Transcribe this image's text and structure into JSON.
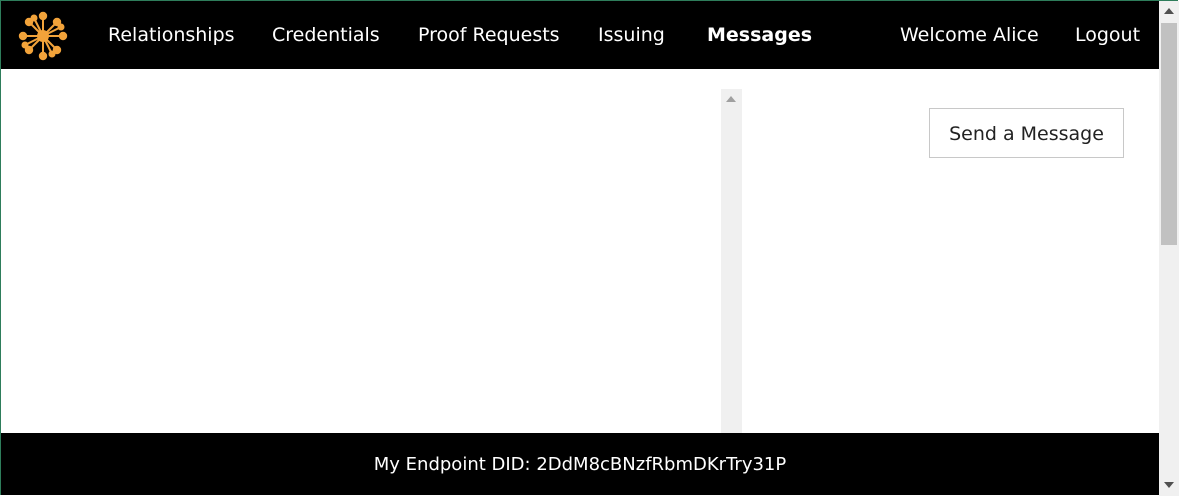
{
  "nav": {
    "logo_icon": "sunburst-logo-icon",
    "items": [
      {
        "label": "Relationships",
        "active": false
      },
      {
        "label": "Credentials",
        "active": false
      },
      {
        "label": "Proof Requests",
        "active": false
      },
      {
        "label": "Issuing",
        "active": false
      },
      {
        "label": "Messages",
        "active": true
      }
    ],
    "welcome": "Welcome Alice",
    "logout": "Logout"
  },
  "main": {
    "send_message_label": "Send a Message"
  },
  "footer": {
    "endpoint_did": "My Endpoint DID: 2DdM8cBNzfRbmDKrTry31P"
  },
  "colors": {
    "nav_background": "#000000",
    "footer_background": "#000000",
    "logo_accent": "#f2a33a",
    "border": "#2e7d5b"
  }
}
